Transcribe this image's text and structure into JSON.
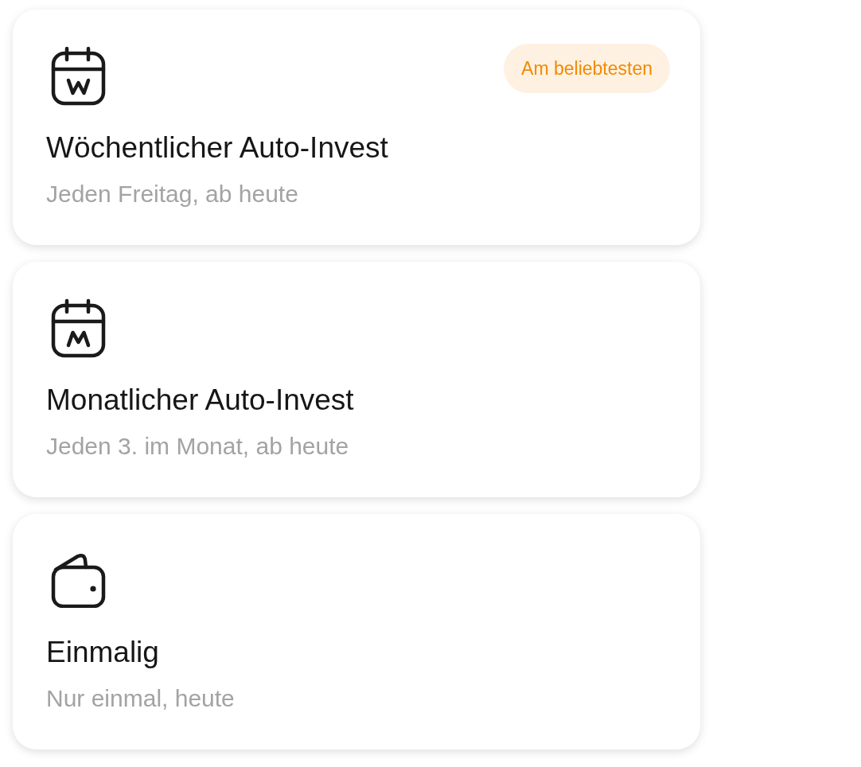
{
  "options": [
    {
      "kind": "weekly",
      "title": "Wöchentlicher Auto-Invest",
      "subtitle": "Jeden Freitag, ab heute",
      "badge": "Am beliebtesten"
    },
    {
      "kind": "monthly",
      "title": "Monatlicher Auto-Invest",
      "subtitle": "Jeden 3. im Monat, ab heute"
    },
    {
      "kind": "once",
      "title": "Einmalig",
      "subtitle": "Nur einmal, heute"
    }
  ]
}
